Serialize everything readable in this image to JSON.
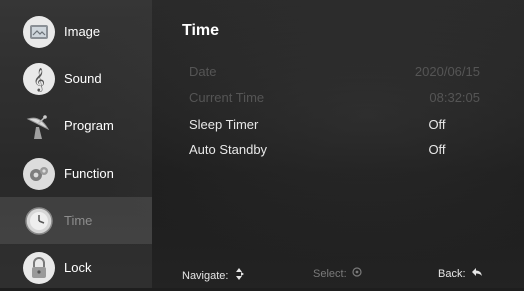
{
  "sidebar": {
    "items": [
      {
        "label": "Image",
        "icon": "image-icon"
      },
      {
        "label": "Sound",
        "icon": "music-note-icon"
      },
      {
        "label": "Program",
        "icon": "satellite-dish-icon"
      },
      {
        "label": "Function",
        "icon": "gears-icon"
      },
      {
        "label": "Time",
        "icon": "clock-icon",
        "selected": true
      },
      {
        "label": "Lock",
        "icon": "padlock-icon"
      }
    ]
  },
  "main": {
    "title": "Time",
    "rows": [
      {
        "label": "Date",
        "value": "2020/06/15",
        "enabled": false
      },
      {
        "label": "Current Time",
        "value": "08:32:05",
        "enabled": false
      },
      {
        "label": "Sleep Timer",
        "value": "Off",
        "enabled": true
      },
      {
        "label": "Auto Standby",
        "value": "Off",
        "enabled": true
      }
    ]
  },
  "footer": {
    "navigate": "Navigate:",
    "select": "Select:",
    "back": "Back:"
  },
  "colors": {
    "text": "#ffffff",
    "disabled_text": "#555555",
    "background": "#1e1e1e"
  }
}
